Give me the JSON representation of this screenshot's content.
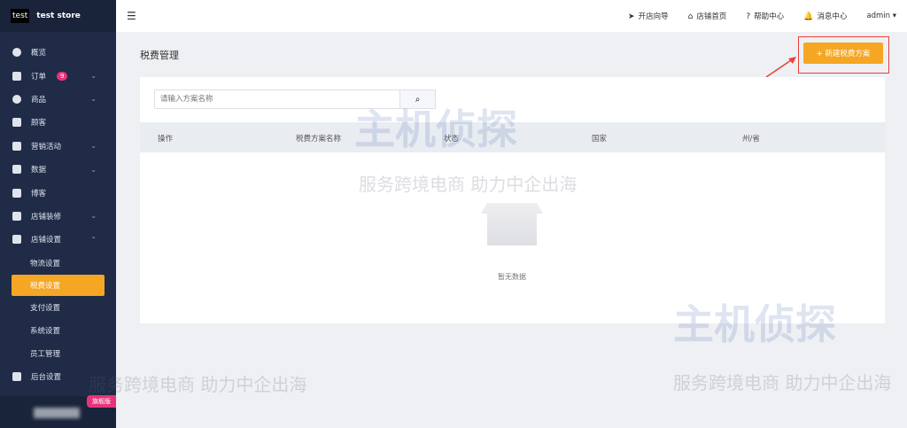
{
  "brand": {
    "logo": "test",
    "name": "test store"
  },
  "sidebar": {
    "items": [
      {
        "label": "概览",
        "icon": "dashboard-icon"
      },
      {
        "label": "订单",
        "icon": "order-icon",
        "badge": "9",
        "chevron": "⌄"
      },
      {
        "label": "商品",
        "icon": "product-icon",
        "chevron": "⌄"
      },
      {
        "label": "顾客",
        "icon": "user-icon"
      },
      {
        "label": "营销活动",
        "icon": "tag-icon",
        "chevron": "⌄"
      },
      {
        "label": "数据",
        "icon": "chart-icon",
        "chevron": "⌄"
      },
      {
        "label": "博客",
        "icon": "blog-icon"
      },
      {
        "label": "店铺装修",
        "icon": "paint-icon",
        "chevron": "⌄"
      },
      {
        "label": "店铺设置",
        "icon": "store-settings-icon",
        "chevron": "⌃"
      }
    ],
    "subitems": [
      "物流设置",
      "税费设置",
      "支付设置",
      "系统设置",
      "员工管理"
    ],
    "last": {
      "label": "后台设置",
      "icon": "admin-settings-icon"
    },
    "plan_badge": "旗舰版"
  },
  "topbar": {
    "menu_icon": "☰",
    "links": [
      {
        "icon": "➤",
        "label": "开店向导"
      },
      {
        "icon": "⌂",
        "label": "店铺首页"
      },
      {
        "icon": "?",
        "label": "帮助中心"
      },
      {
        "icon": "🔔",
        "label": "消息中心"
      }
    ],
    "user": "admin",
    "user_caret": "▾"
  },
  "page": {
    "title": "税费管理",
    "new_button": "+ 新建税费方案",
    "search_placeholder": "请输入方案名称",
    "search_icon": "⌕",
    "columns": [
      "操作",
      "税费方案名称",
      "状态",
      "国家",
      "州/省"
    ],
    "empty_text": "暂无数据"
  },
  "watermark": {
    "title": "主机侦探",
    "slogan": "服务跨境电商 助力中企出海"
  },
  "colors": {
    "accent": "#f5a623",
    "sidebar": "#1f2b47",
    "badge": "#e8337a"
  }
}
